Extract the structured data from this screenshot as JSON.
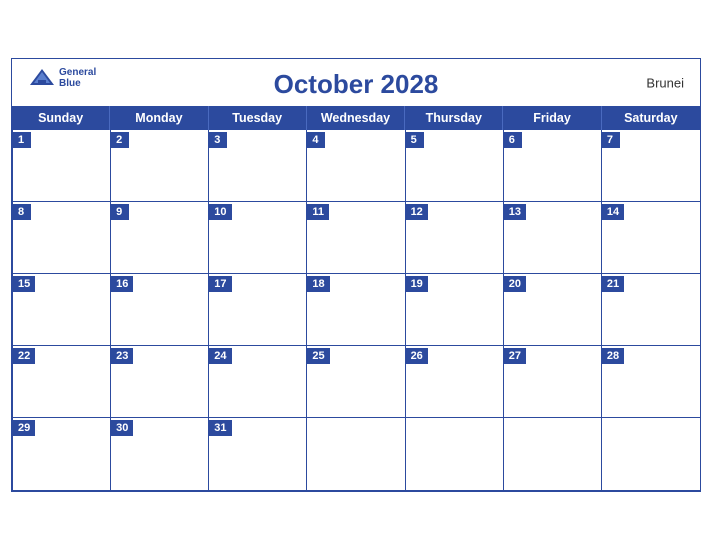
{
  "header": {
    "title": "October 2028",
    "country": "Brunei",
    "logo": {
      "line1": "General",
      "line2": "Blue"
    }
  },
  "days": [
    "Sunday",
    "Monday",
    "Tuesday",
    "Wednesday",
    "Thursday",
    "Friday",
    "Saturday"
  ],
  "weeks": [
    [
      {
        "date": "1",
        "empty": false
      },
      {
        "date": "2",
        "empty": false
      },
      {
        "date": "3",
        "empty": false
      },
      {
        "date": "4",
        "empty": false
      },
      {
        "date": "5",
        "empty": false
      },
      {
        "date": "6",
        "empty": false
      },
      {
        "date": "7",
        "empty": false
      }
    ],
    [
      {
        "date": "8",
        "empty": false
      },
      {
        "date": "9",
        "empty": false
      },
      {
        "date": "10",
        "empty": false
      },
      {
        "date": "11",
        "empty": false
      },
      {
        "date": "12",
        "empty": false
      },
      {
        "date": "13",
        "empty": false
      },
      {
        "date": "14",
        "empty": false
      }
    ],
    [
      {
        "date": "15",
        "empty": false
      },
      {
        "date": "16",
        "empty": false
      },
      {
        "date": "17",
        "empty": false
      },
      {
        "date": "18",
        "empty": false
      },
      {
        "date": "19",
        "empty": false
      },
      {
        "date": "20",
        "empty": false
      },
      {
        "date": "21",
        "empty": false
      }
    ],
    [
      {
        "date": "22",
        "empty": false
      },
      {
        "date": "23",
        "empty": false
      },
      {
        "date": "24",
        "empty": false
      },
      {
        "date": "25",
        "empty": false
      },
      {
        "date": "26",
        "empty": false
      },
      {
        "date": "27",
        "empty": false
      },
      {
        "date": "28",
        "empty": false
      }
    ],
    [
      {
        "date": "29",
        "empty": false
      },
      {
        "date": "30",
        "empty": false
      },
      {
        "date": "31",
        "empty": false
      },
      {
        "date": "",
        "empty": true
      },
      {
        "date": "",
        "empty": true
      },
      {
        "date": "",
        "empty": true
      },
      {
        "date": "",
        "empty": true
      }
    ]
  ]
}
